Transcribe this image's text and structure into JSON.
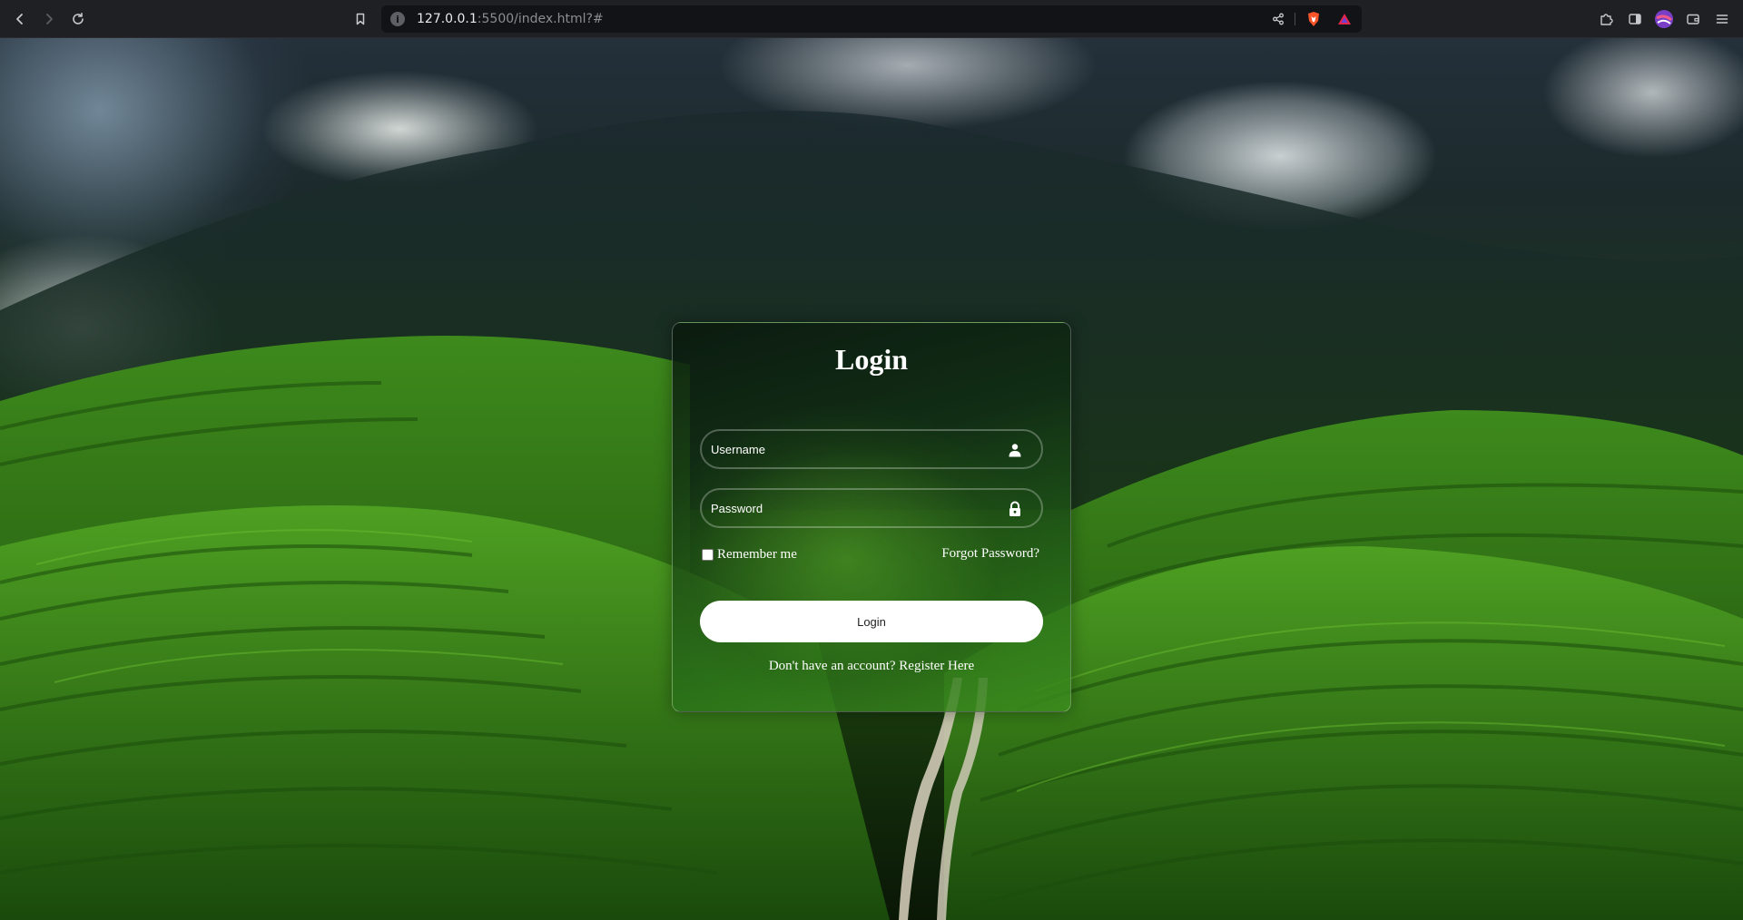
{
  "browser": {
    "url_host": "127.0.0.1",
    "url_rest": ":5500/index.html?#"
  },
  "icons": {
    "back": "chevron-left-icon",
    "forward": "chevron-right-icon",
    "reload": "reload-icon",
    "bookmark": "bookmark-icon",
    "site_info": "info-icon",
    "share": "share-icon",
    "brave_shields": "brave-shield-icon",
    "brave_rewards": "brave-rewards-icon",
    "extensions": "puzzle-icon",
    "sidebar": "sidebar-icon",
    "profile": "profile-avatar-icon",
    "wallet": "wallet-icon",
    "menu": "hamburger-menu-icon",
    "username": "user-icon",
    "password": "lock-icon"
  },
  "login": {
    "title": "Login",
    "username_placeholder": "Username",
    "password_placeholder": "Password",
    "remember_label": "Remember me",
    "forgot_label": "Forgot Password?",
    "button_label": "Login",
    "register_prompt": "Don't have an account? ",
    "register_link": "Register Here"
  },
  "colors": {
    "card_accent": "#3f8f1f",
    "button_bg": "#ffffff",
    "text": "#ffffff"
  }
}
